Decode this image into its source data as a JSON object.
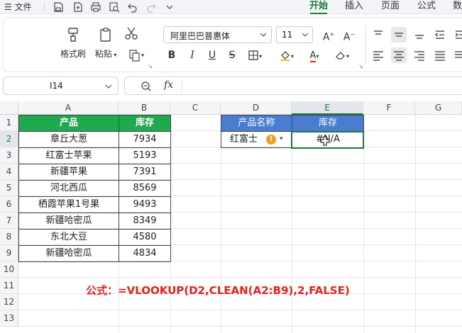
{
  "menu": {
    "file_label": "文件",
    "tabs": [
      {
        "label": "开始",
        "active": true
      },
      {
        "label": "插入",
        "active": false
      },
      {
        "label": "页面",
        "active": false
      },
      {
        "label": "公式",
        "active": false
      },
      {
        "label": "数",
        "active": false
      }
    ]
  },
  "ribbon": {
    "format_painter": "格式刷",
    "paste": "粘贴",
    "font_name": "阿里巴巴普惠体",
    "font_size": "11"
  },
  "formula_bar": {
    "name_box": "I14",
    "fx_label": "fx",
    "content": ""
  },
  "sheet": {
    "columns": [
      "A",
      "B",
      "C",
      "D",
      "E",
      "F",
      "G"
    ],
    "rows": [
      "1",
      "2",
      "3",
      "4",
      "5",
      "6",
      "7",
      "8",
      "9",
      "10",
      "11",
      "12",
      "13"
    ],
    "selected_column": "E",
    "selected_row": "2",
    "table1": {
      "headers": [
        "产品",
        "库存"
      ],
      "rows": [
        [
          "章丘大葱",
          "7934"
        ],
        [
          "红富士苹果",
          "5193"
        ],
        [
          "新疆苹果",
          "7391"
        ],
        [
          "河北西瓜",
          "8569"
        ],
        [
          "栖霞苹果1号果",
          "9493"
        ],
        [
          "新疆哈密瓜",
          "8349"
        ],
        [
          "东北大豆",
          "4580"
        ],
        [
          "新疆哈密瓜",
          "4834"
        ]
      ]
    },
    "lookup": {
      "header_name": "产品名称",
      "header_stock": "库存",
      "name_value": "红富士",
      "result_value": "#N/A",
      "warning_glyph": "!"
    },
    "note": "公式：=VLOOKUP(D2,CLEAN(A2:B9),2,FALSE)"
  },
  "colors": {
    "accent": "#1f7a3f",
    "header_green": "#1faa50",
    "header_blue": "#4a7dd0",
    "note_red": "#e8201e",
    "warning": "#f0a024"
  }
}
